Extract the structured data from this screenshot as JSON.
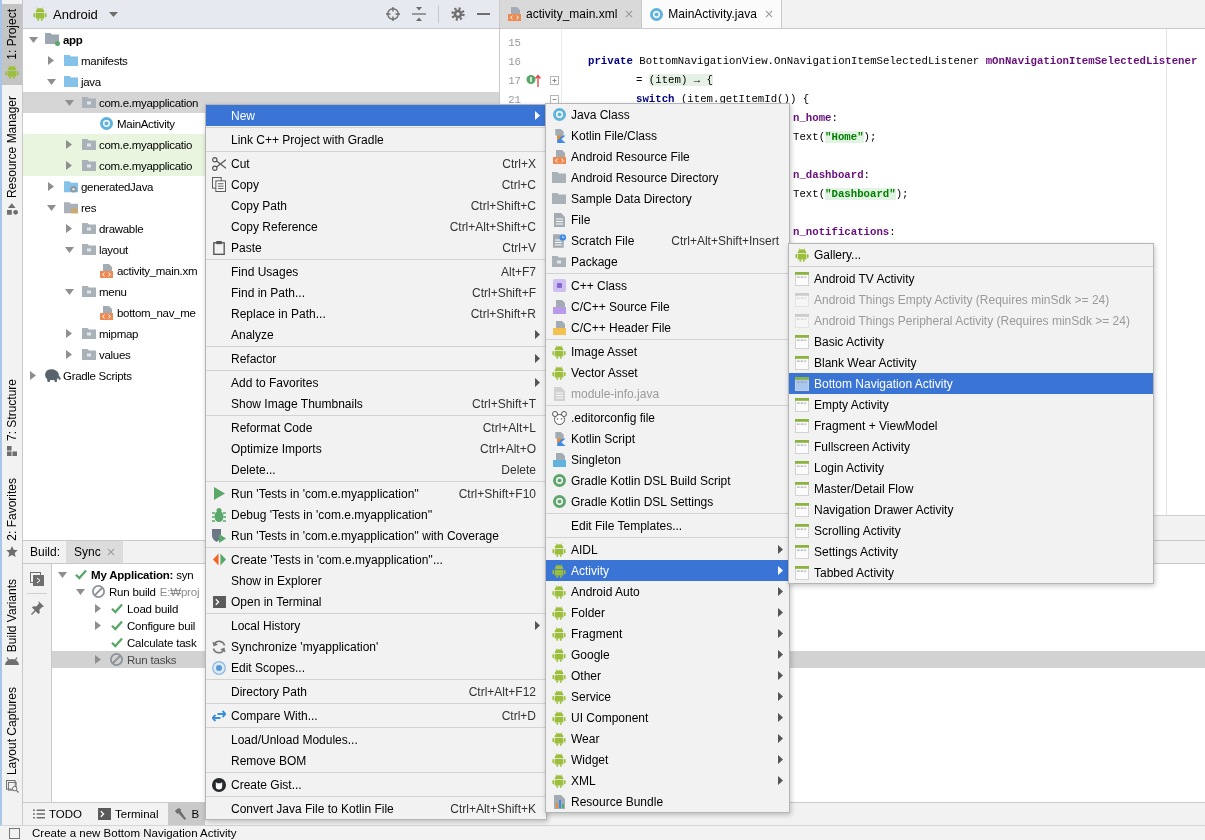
{
  "tool_strip": {
    "top": [
      {
        "label": "1: Project",
        "kind": "project",
        "selected": true
      },
      {
        "label": "Resource Manager",
        "kind": "resources",
        "selected": false
      }
    ],
    "bottom": [
      {
        "label": "7: Structure",
        "kind": "structure",
        "selected": false
      },
      {
        "label": "2: Favorites",
        "kind": "favorites",
        "selected": false
      },
      {
        "label": "Build Variants",
        "kind": "variants",
        "selected": false
      },
      {
        "label": "Layout Captures",
        "kind": "captures",
        "selected": false
      }
    ]
  },
  "project_panel": {
    "view": "Android",
    "tree": [
      {
        "label": "app",
        "kind": "module",
        "expanded": true,
        "selected": false,
        "test": false,
        "children": [
          {
            "label": "manifests",
            "kind": "source",
            "expanded": false,
            "selected": false,
            "test": false
          },
          {
            "label": "java",
            "kind": "source",
            "expanded": true,
            "selected": false,
            "test": false,
            "children": [
              {
                "label": "com.e.myapplication",
                "kind": "folder",
                "expanded": true,
                "selected": true,
                "test": false,
                "children": [
                  {
                    "label": "MainActivity",
                    "kind": "class",
                    "selected": false,
                    "test": false
                  }
                ]
              },
              {
                "label": "com.e.myapplicatio",
                "kind": "folder",
                "expanded": false,
                "selected": false,
                "test": true
              },
              {
                "label": "com.e.myapplicatio",
                "kind": "folder",
                "expanded": false,
                "selected": false,
                "test": true
              }
            ]
          },
          {
            "label": "generatedJava",
            "kind": "generated",
            "expanded": false,
            "selected": false,
            "test": false
          },
          {
            "label": "res",
            "kind": "res",
            "expanded": true,
            "selected": false,
            "test": false,
            "children": [
              {
                "label": "drawable",
                "kind": "folder",
                "expanded": false,
                "selected": false,
                "test": false
              },
              {
                "label": "layout",
                "kind": "folder",
                "expanded": true,
                "selected": false,
                "test": false,
                "children": [
                  {
                    "label": "activity_main.xm",
                    "kind": "xml",
                    "selected": false,
                    "test": false
                  }
                ]
              },
              {
                "label": "menu",
                "kind": "folder",
                "expanded": true,
                "selected": false,
                "test": false,
                "children": [
                  {
                    "label": "bottom_nav_me",
                    "kind": "xml",
                    "selected": false,
                    "test": false
                  }
                ]
              },
              {
                "label": "mipmap",
                "kind": "folder",
                "expanded": false,
                "selected": false,
                "test": false
              },
              {
                "label": "values",
                "kind": "folder",
                "expanded": false,
                "selected": false,
                "test": false
              }
            ]
          }
        ]
      },
      {
        "label": "Gradle Scripts",
        "kind": "gradle",
        "expanded": false,
        "selected": false,
        "test": false
      }
    ]
  },
  "editor": {
    "tabs": [
      {
        "label": "activity_main.xml",
        "kind": "xml",
        "selected": false
      },
      {
        "label": "MainActivity.java",
        "kind": "class",
        "selected": true
      }
    ],
    "lines": [
      {
        "number": "15",
        "marker": false
      },
      {
        "number": "16",
        "marker": false,
        "kind": "declaration",
        "tokens": [
          {
            "text": "private",
            "kind": "keyword"
          },
          {
            "text": " BottomNavigationView.OnNavigationItemSelectedListener ",
            "kind": "plain"
          },
          {
            "text": "mOnNavigationItemSelectedListener",
            "kind": "field"
          }
        ]
      },
      {
        "number": "17",
        "marker": true,
        "folded": true,
        "kind": "body",
        "tokens": [
          {
            "text": "= ",
            "kind": "plain"
          },
          {
            "text": "(item) → {",
            "kind": "folded"
          }
        ]
      },
      {
        "number": "21",
        "marker": false,
        "folded": false,
        "kind": "body",
        "tokens": [
          {
            "text": "switch",
            "kind": "keyword"
          },
          {
            "text": " (item.getItemId()) {",
            "kind": "plain"
          }
        ]
      },
      {
        "kind": "clipped",
        "gap_before": false,
        "tokens": [
          {
            "text": "n_home",
            "kind": "field"
          },
          {
            "text": ":",
            "kind": "plain"
          }
        ]
      },
      {
        "kind": "clipped",
        "gap_before": false,
        "tokens": [
          {
            "text": "Text(",
            "kind": "plain"
          },
          {
            "text": "\"Home\"",
            "kind": "string"
          },
          {
            "text": ");",
            "kind": "plain"
          }
        ]
      },
      {
        "kind": "clipped",
        "gap_before": true,
        "tokens": [
          {
            "text": "n_dashboard",
            "kind": "field"
          },
          {
            "text": ":",
            "kind": "plain"
          }
        ]
      },
      {
        "kind": "clipped",
        "gap_before": false,
        "tokens": [
          {
            "text": "Text(",
            "kind": "plain"
          },
          {
            "text": "\"Dashboard\"",
            "kind": "string"
          },
          {
            "text": ");",
            "kind": "plain"
          }
        ]
      },
      {
        "kind": "clipped",
        "gap_before": true,
        "tokens": [
          {
            "text": "n_notifications",
            "kind": "field"
          },
          {
            "text": ":",
            "kind": "plain"
          }
        ]
      }
    ]
  },
  "build_panel": {
    "title": "Build:",
    "tabs": [
      {
        "label": "Sync",
        "selected": true
      }
    ],
    "tree": [
      {
        "label": "**My Application:** syn",
        "kind": "success",
        "expanded": true,
        "selected": false,
        "children": [
          {
            "label": "Run build",
            "detail": "E:₩proj",
            "kind": "cancelled",
            "expanded": true,
            "selected": false,
            "children": [
              {
                "label": "Load build",
                "kind": "success",
                "expanded": false,
                "selected": false
              },
              {
                "label": "Configure buil",
                "kind": "success",
                "expanded": false,
                "selected": false
              },
              {
                "label": "Calculate task",
                "kind": "success",
                "selected": false
              },
              {
                "label": "Run tasks",
                "kind": "cancelled",
                "expanded": false,
                "selected": true
              }
            ]
          }
        ]
      }
    ]
  },
  "bottom_bar": {
    "buttons": [
      {
        "label": "TODO",
        "kind": "todo",
        "selected": false
      },
      {
        "label": "Terminal",
        "kind": "terminal",
        "selected": false
      },
      {
        "label": "B",
        "kind": "build",
        "selected": true
      }
    ]
  },
  "status_bar": {
    "message": "Create a new Bottom Navigation Activity"
  },
  "context_menu": {
    "groups": [
      [
        {
          "label": "New",
          "submenu": true,
          "selected": true
        }
      ],
      [
        {
          "label": "Link C++ Project with Gradle",
          "submenu": false,
          "selected": false
        }
      ],
      [
        {
          "label": "Cut",
          "kind": "cut",
          "shortcut": "Ctrl+X",
          "submenu": false,
          "selected": false
        },
        {
          "label": "Copy",
          "kind": "copy",
          "shortcut": "Ctrl+C",
          "submenu": false,
          "selected": false
        },
        {
          "label": "Copy Path",
          "shortcut": "Ctrl+Shift+C",
          "submenu": false,
          "selected": false
        },
        {
          "label": "Copy Reference",
          "shortcut": "Ctrl+Alt+Shift+C",
          "submenu": false,
          "selected": false
        },
        {
          "label": "Paste",
          "kind": "paste",
          "shortcut": "Ctrl+V",
          "submenu": false,
          "selected": false
        }
      ],
      [
        {
          "label": "Find Usages",
          "shortcut": "Alt+F7",
          "submenu": false,
          "selected": false
        },
        {
          "label": "Find in Path...",
          "shortcut": "Ctrl+Shift+F",
          "submenu": false,
          "selected": false
        },
        {
          "label": "Replace in Path...",
          "shortcut": "Ctrl+Shift+R",
          "submenu": false,
          "selected": false
        },
        {
          "label": "Analyze",
          "submenu": true,
          "selected": false
        }
      ],
      [
        {
          "label": "Refactor",
          "submenu": true,
          "selected": false
        }
      ],
      [
        {
          "label": "Add to Favorites",
          "submenu": true,
          "selected": false
        },
        {
          "label": "Show Image Thumbnails",
          "shortcut": "Ctrl+Shift+T",
          "submenu": false,
          "selected": false
        }
      ],
      [
        {
          "label": "Reformat Code",
          "shortcut": "Ctrl+Alt+L",
          "submenu": false,
          "selected": false
        },
        {
          "label": "Optimize Imports",
          "shortcut": "Ctrl+Alt+O",
          "submenu": false,
          "selected": false
        },
        {
          "label": "Delete...",
          "shortcut": "Delete",
          "submenu": false,
          "selected": false
        }
      ],
      [
        {
          "label": "Run 'Tests in 'com.e.myapplication''",
          "kind": "run",
          "shortcut": "Ctrl+Shift+F10",
          "submenu": false,
          "selected": false
        },
        {
          "label": "Debug 'Tests in 'com.e.myapplication''",
          "kind": "debug",
          "submenu": false,
          "selected": false
        },
        {
          "label": "Run 'Tests in 'com.e.myapplication'' with Coverage",
          "kind": "coverage",
          "submenu": false,
          "selected": false
        }
      ],
      [
        {
          "label": "Create 'Tests in 'com.e.myapplication''...",
          "kind": "tests",
          "submenu": false,
          "selected": false
        },
        {
          "label": "Show in Explorer",
          "submenu": false,
          "selected": false
        },
        {
          "label": "Open in Terminal",
          "kind": "terminal",
          "submenu": false,
          "selected": false
        }
      ],
      [
        {
          "label": "Local History",
          "submenu": true,
          "selected": false
        },
        {
          "label": "Synchronize 'myapplication'",
          "kind": "sync",
          "submenu": false,
          "selected": false
        },
        {
          "label": "Edit Scopes...",
          "kind": "scopes",
          "submenu": false,
          "selected": false
        }
      ],
      [
        {
          "label": "Directory Path",
          "shortcut": "Ctrl+Alt+F12",
          "submenu": false,
          "selected": false
        }
      ],
      [
        {
          "label": "Compare With...",
          "kind": "compare",
          "shortcut": "Ctrl+D",
          "submenu": false,
          "selected": false
        }
      ],
      [
        {
          "label": "Load/Unload Modules...",
          "submenu": false,
          "selected": false
        },
        {
          "label": "Remove BOM",
          "submenu": false,
          "selected": false
        }
      ],
      [
        {
          "label": "Create Gist...",
          "kind": "gist",
          "submenu": false,
          "selected": false
        }
      ],
      [
        {
          "label": "Convert Java File to Kotlin File",
          "shortcut": "Ctrl+Alt+Shift+K",
          "submenu": false,
          "selected": false
        }
      ]
    ]
  },
  "new_submenu": {
    "groups": [
      [
        {
          "label": "Java Class",
          "kind": "class",
          "submenu": false,
          "selected": false,
          "disabled": false
        },
        {
          "label": "Kotlin File/Class",
          "kind": "kotlin",
          "submenu": false,
          "selected": false,
          "disabled": false
        },
        {
          "label": "Android Resource File",
          "kind": "resource",
          "submenu": false,
          "selected": false,
          "disabled": false
        },
        {
          "label": "Android Resource Directory",
          "kind": "folder",
          "submenu": false,
          "selected": false,
          "disabled": false
        },
        {
          "label": "Sample Data Directory",
          "kind": "folder",
          "submenu": false,
          "selected": false,
          "disabled": false
        },
        {
          "label": "File",
          "kind": "file",
          "submenu": false,
          "selected": false,
          "disabled": false
        },
        {
          "label": "Scratch File",
          "kind": "scratch",
          "shortcut": "Ctrl+Alt+Shift+Insert",
          "submenu": false,
          "selected": false,
          "disabled": false
        },
        {
          "label": "Package",
          "kind": "package",
          "submenu": false,
          "selected": false,
          "disabled": false
        }
      ],
      [
        {
          "label": "C++ Class",
          "kind": "cppclass",
          "submenu": false,
          "selected": false,
          "disabled": false
        },
        {
          "label": "C/C++ Source File",
          "kind": "cppsource",
          "submenu": false,
          "selected": false,
          "disabled": false
        },
        {
          "label": "C/C++ Header File",
          "kind": "cppheader",
          "submenu": false,
          "selected": false,
          "disabled": false
        }
      ],
      [
        {
          "label": "Image Asset",
          "kind": "android",
          "submenu": false,
          "selected": false,
          "disabled": false
        },
        {
          "label": "Vector Asset",
          "kind": "android",
          "submenu": false,
          "selected": false,
          "disabled": false
        },
        {
          "label": "module-info.java",
          "kind": "file",
          "submenu": false,
          "selected": false,
          "disabled": true
        }
      ],
      [
        {
          "label": ".editorconfig file",
          "kind": "editorconfig",
          "submenu": false,
          "selected": false,
          "disabled": false
        },
        {
          "label": "Kotlin Script",
          "kind": "kotlin",
          "submenu": false,
          "selected": false,
          "disabled": false
        },
        {
          "label": "Singleton",
          "kind": "singleton",
          "submenu": false,
          "selected": false,
          "disabled": false
        },
        {
          "label": "Gradle Kotlin DSL Build Script",
          "kind": "gradle",
          "submenu": false,
          "selected": false,
          "disabled": false
        },
        {
          "label": "Gradle Kotlin DSL Settings",
          "kind": "gradle",
          "submenu": false,
          "selected": false,
          "disabled": false
        }
      ],
      [
        {
          "label": "Edit File Templates...",
          "submenu": false,
          "selected": false,
          "disabled": false
        }
      ],
      [
        {
          "label": "AIDL",
          "kind": "android",
          "submenu": true,
          "selected": false,
          "disabled": false
        },
        {
          "label": "Activity",
          "kind": "android",
          "submenu": true,
          "selected": true,
          "disabled": false
        },
        {
          "label": "Android Auto",
          "kind": "android",
          "submenu": true,
          "selected": false,
          "disabled": false
        },
        {
          "label": "Folder",
          "kind": "android",
          "submenu": true,
          "selected": false,
          "disabled": false
        },
        {
          "label": "Fragment",
          "kind": "android",
          "submenu": true,
          "selected": false,
          "disabled": false
        },
        {
          "label": "Google",
          "kind": "android",
          "submenu": true,
          "selected": false,
          "disabled": false
        },
        {
          "label": "Other",
          "kind": "android",
          "submenu": true,
          "selected": false,
          "disabled": false
        },
        {
          "label": "Service",
          "kind": "android",
          "submenu": true,
          "selected": false,
          "disabled": false
        },
        {
          "label": "UI Component",
          "kind": "android",
          "submenu": true,
          "selected": false,
          "disabled": false
        },
        {
          "label": "Wear",
          "kind": "android",
          "submenu": true,
          "selected": false,
          "disabled": false
        },
        {
          "label": "Widget",
          "kind": "android",
          "submenu": true,
          "selected": false,
          "disabled": false
        },
        {
          "label": "XML",
          "kind": "android",
          "submenu": true,
          "selected": false,
          "disabled": false
        },
        {
          "label": "Resource Bundle",
          "kind": "bundle",
          "submenu": false,
          "selected": false,
          "disabled": false
        }
      ]
    ]
  },
  "activity_submenu": {
    "groups": [
      [
        {
          "label": "Gallery...",
          "kind": "android",
          "selected": false,
          "disabled": false
        }
      ],
      [
        {
          "label": "Android TV Activity",
          "kind": "template",
          "selected": false,
          "disabled": false
        },
        {
          "label": "Android Things Empty Activity (Requires minSdk >= 24)",
          "kind": "template",
          "selected": false,
          "disabled": true
        },
        {
          "label": "Android Things Peripheral Activity (Requires minSdk >= 24)",
          "kind": "template",
          "selected": false,
          "disabled": true
        },
        {
          "label": "Basic Activity",
          "kind": "template",
          "selected": false,
          "disabled": false
        },
        {
          "label": "Blank Wear Activity",
          "kind": "template",
          "selected": false,
          "disabled": false
        },
        {
          "label": "Bottom Navigation Activity",
          "kind": "template",
          "selected": true,
          "disabled": false
        },
        {
          "label": "Empty Activity",
          "kind": "template",
          "selected": false,
          "disabled": false
        },
        {
          "label": "Fragment + ViewModel",
          "kind": "template",
          "selected": false,
          "disabled": false
        },
        {
          "label": "Fullscreen Activity",
          "kind": "template",
          "selected": false,
          "disabled": false
        },
        {
          "label": "Login Activity",
          "kind": "template",
          "selected": false,
          "disabled": false
        },
        {
          "label": "Master/Detail Flow",
          "kind": "template",
          "selected": false,
          "disabled": false
        },
        {
          "label": "Navigation Drawer Activity",
          "kind": "template",
          "selected": false,
          "disabled": false
        },
        {
          "label": "Scrolling Activity",
          "kind": "template",
          "selected": false,
          "disabled": false
        },
        {
          "label": "Settings Activity",
          "kind": "template",
          "selected": false,
          "disabled": false
        },
        {
          "label": "Tabbed Activity",
          "kind": "template",
          "selected": false,
          "disabled": false
        }
      ]
    ]
  }
}
